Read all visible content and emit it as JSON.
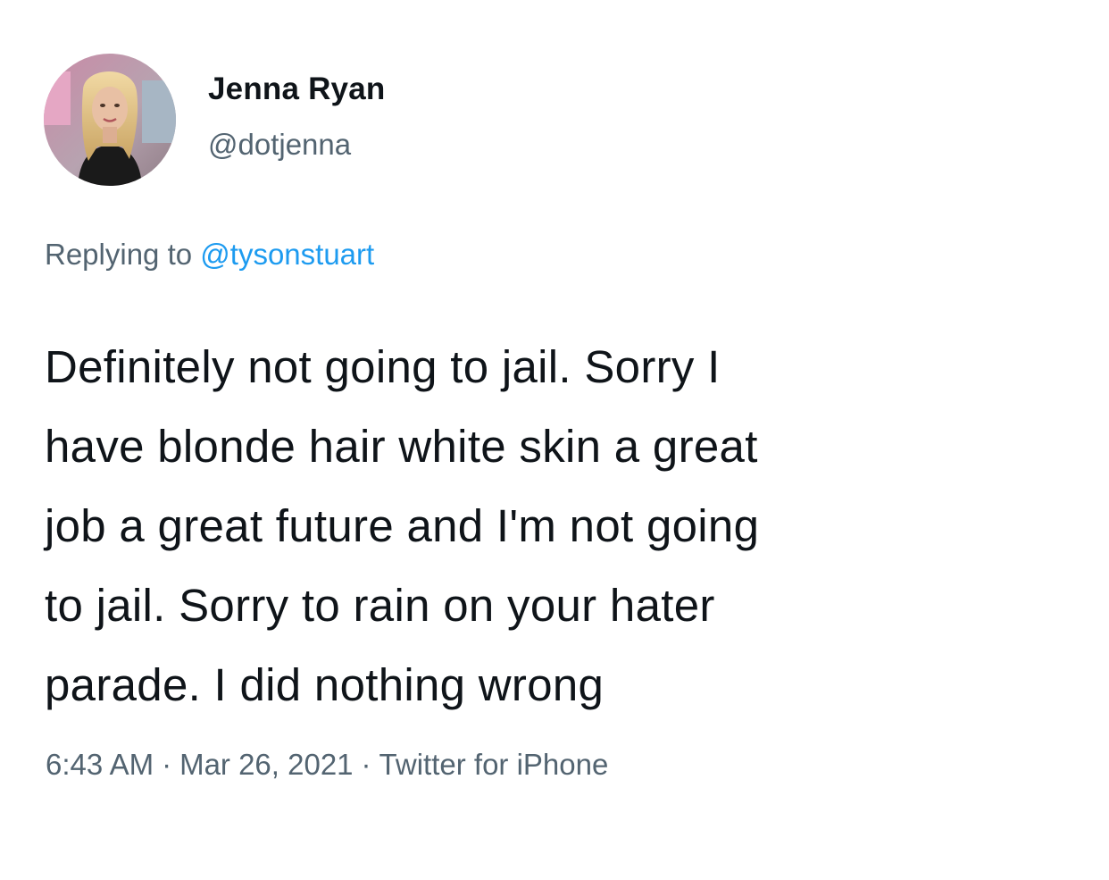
{
  "author": {
    "display_name": "Jenna Ryan",
    "handle": "@dotjenna"
  },
  "reply": {
    "prefix": "Replying to",
    "mention": "@tysonstuart"
  },
  "tweet": {
    "lines": [
      "Definitely not going to jail. Sorry I",
      "have blonde hair white skin a great",
      "job a great future and I'm not going",
      "to jail. Sorry to rain on your hater",
      "parade. I did nothing wrong"
    ]
  },
  "meta": {
    "time": "6:43 AM",
    "separator": "·",
    "date": "Mar 26, 2021",
    "source": "Twitter for iPhone"
  },
  "colors": {
    "text_primary": "#0f1419",
    "text_secondary": "#536471",
    "accent": "#1d9bf0"
  }
}
